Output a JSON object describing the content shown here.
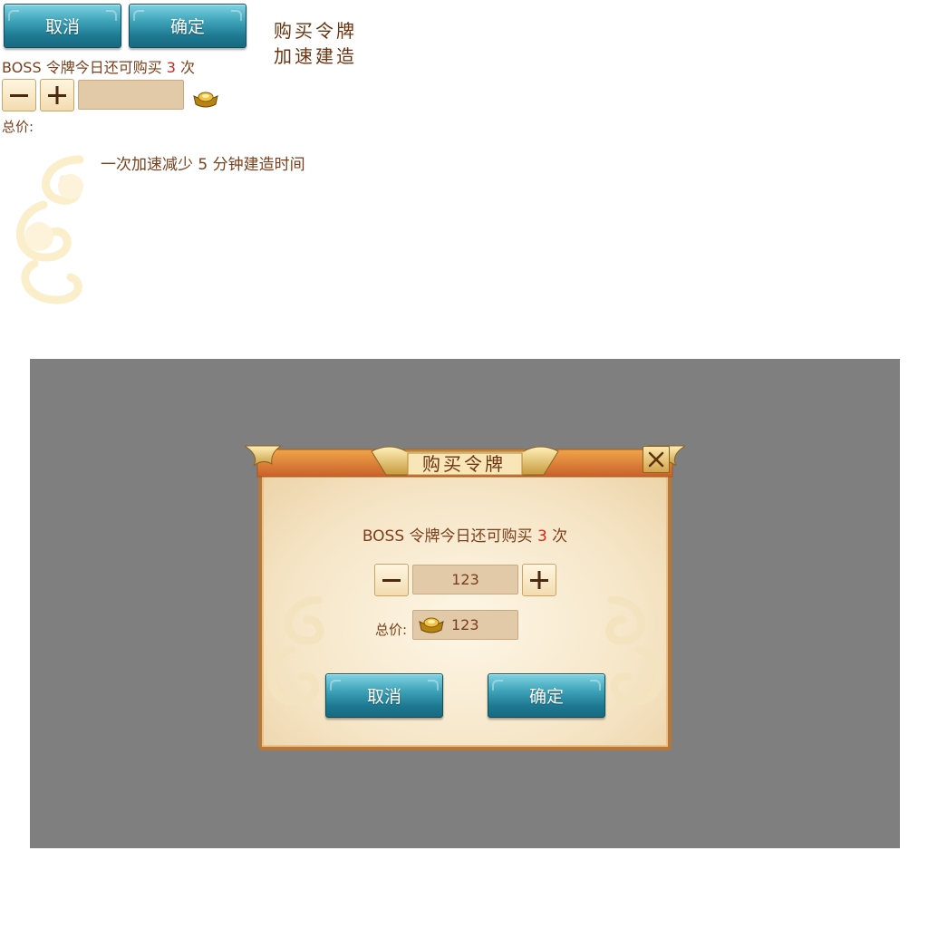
{
  "assets": {
    "cancel_label": "取消",
    "confirm_label": "确定",
    "title_art_line1": "购买令牌",
    "title_art_line2": "加速建造",
    "buy_prefix": "BOSS 令牌今日还可购买 ",
    "buy_count": "3",
    "buy_suffix": " 次",
    "minus_label": "−",
    "plus_label": "+",
    "total_label": "总价:",
    "speedup_text": "一次加速减少 5 分钟建造时间"
  },
  "dialog": {
    "title": "购买令牌",
    "close_label": "✕",
    "buy_prefix": "BOSS 令牌今日还可购买 ",
    "buy_count": "3",
    "buy_suffix": " 次",
    "quantity_value": "123",
    "total_label": "总价:",
    "total_value": "123",
    "cancel_label": "取消",
    "confirm_label": "确定"
  },
  "colors": {
    "overlay": "#7f7f7f",
    "text_brown": "#7a3f1a",
    "count_red": "#d7261c",
    "button_teal": "#2a8ca4",
    "frame_orange": "#d9772c"
  },
  "icons": [
    "gold-ingot-icon",
    "minus-icon",
    "plus-icon",
    "close-icon",
    "cloud-ornament-icon"
  ]
}
